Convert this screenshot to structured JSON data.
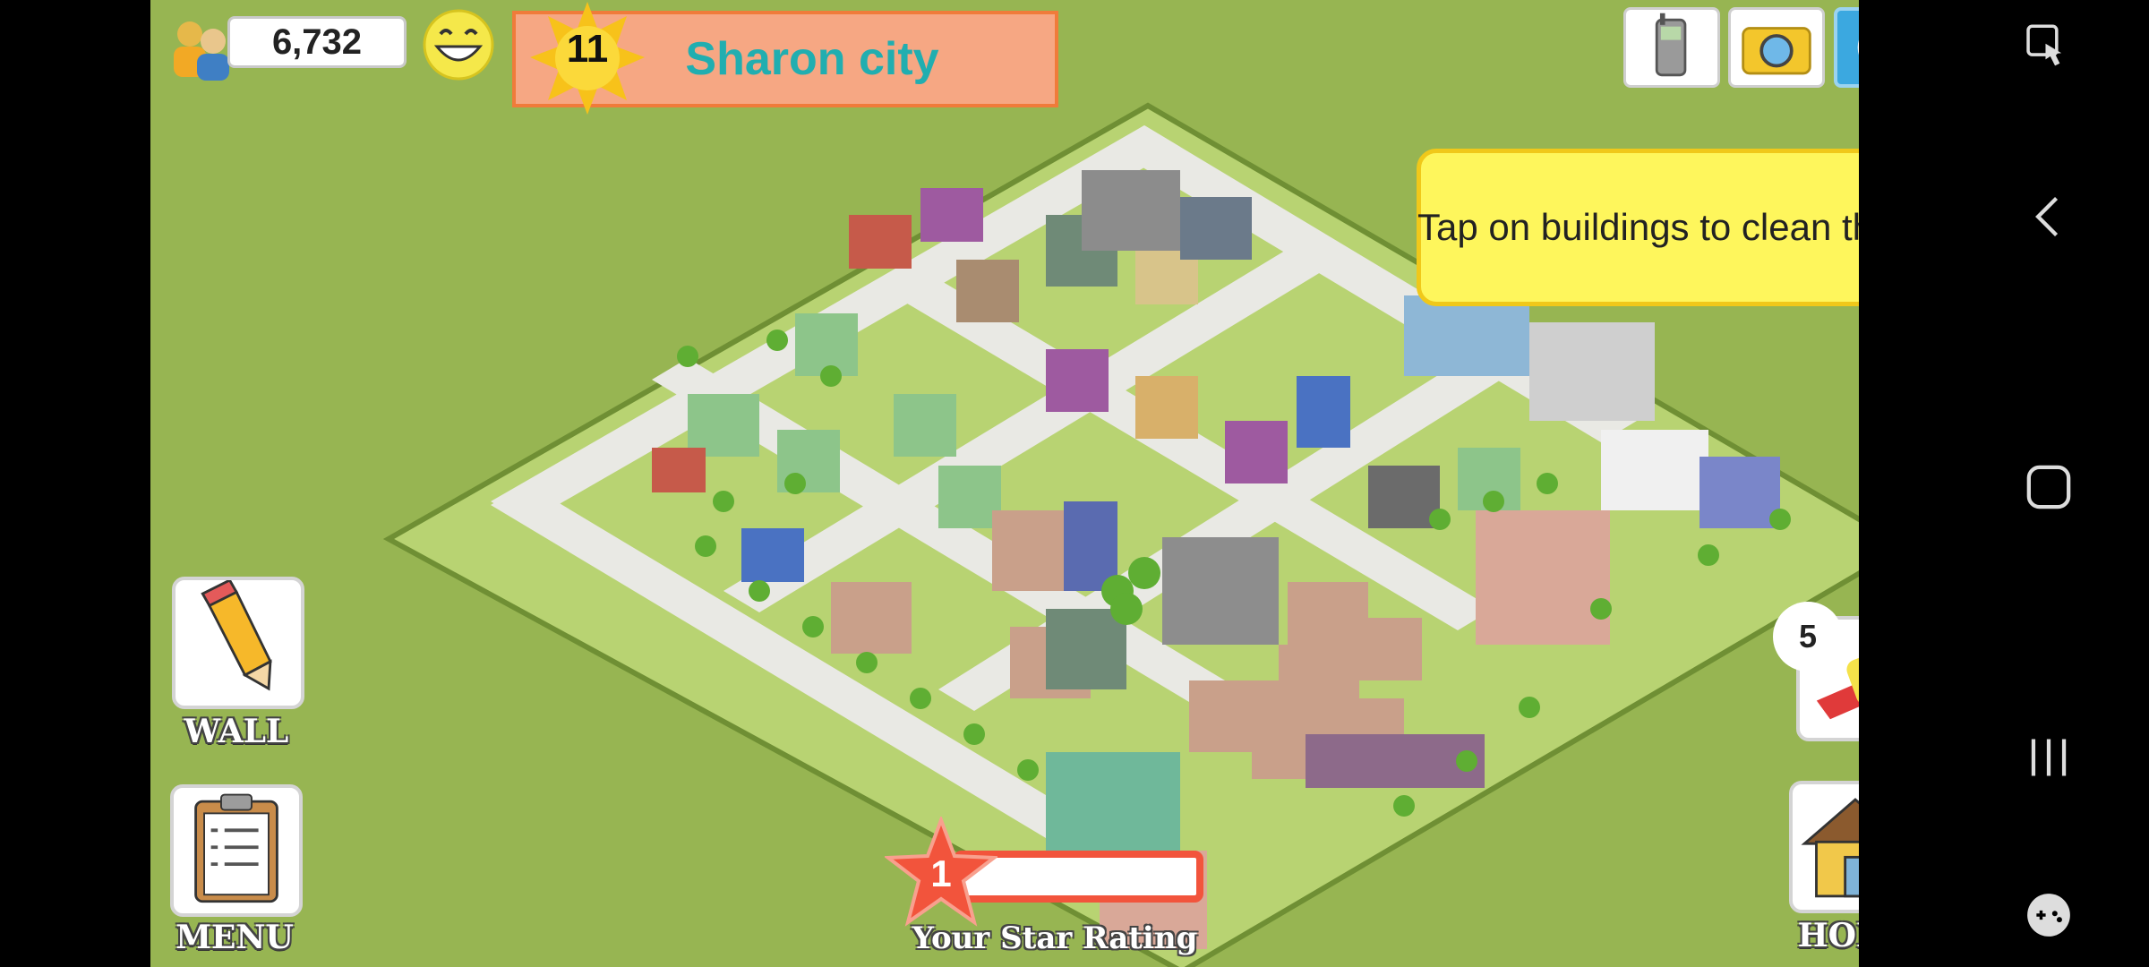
{
  "hud": {
    "population": "6,732",
    "level": "11",
    "city_name": "Sharon city"
  },
  "tooltip": {
    "text": "Tap on buildings to clean them."
  },
  "buttons": {
    "wall_label": "WALL",
    "menu_label": "MENU",
    "home_label": "HOME",
    "clean_count": "5"
  },
  "star_rating": {
    "value": "1",
    "label": "Your Star Rating",
    "progress": 0
  },
  "icons": {
    "population": "people-icon",
    "happiness": "smiley-icon",
    "level": "sun-icon",
    "phone": "phone-icon",
    "camera": "camera-icon",
    "share": "share-icon",
    "wall": "pencil-icon",
    "menu": "clipboard-icon",
    "home": "house-icon",
    "clean": "sponge-icon"
  },
  "colors": {
    "grass": "#97b552",
    "board": "#b8d372",
    "road": "#e9e9e4",
    "tooltip": "#fef65c",
    "city_name": "#21aeb0",
    "banner": "#f6a783",
    "rating": "#f2543c"
  }
}
